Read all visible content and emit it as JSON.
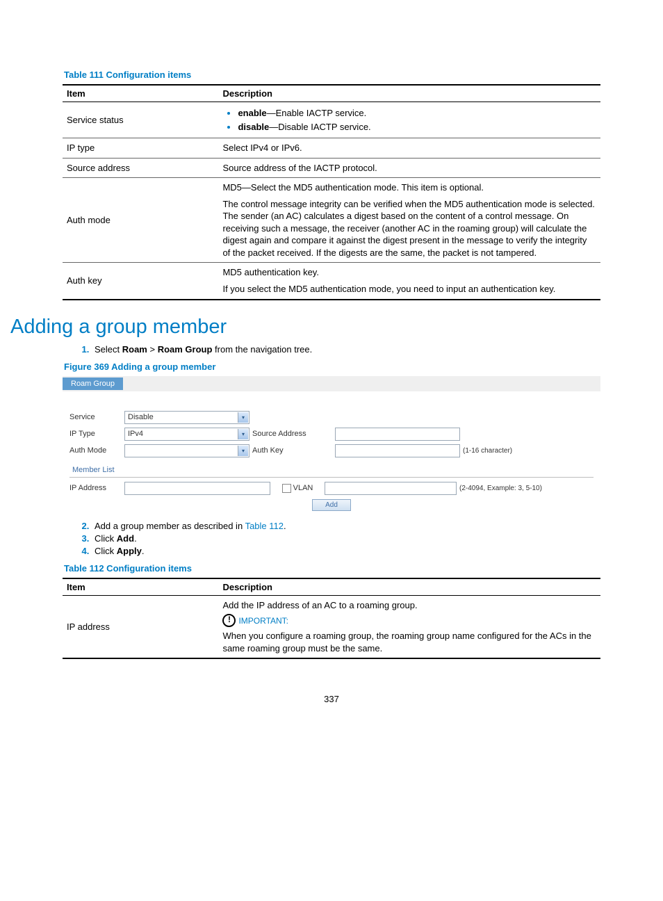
{
  "page_number": "337",
  "table111": {
    "caption": "Table 111 Configuration items",
    "head": {
      "c1": "Item",
      "c2": "Description"
    },
    "rows": {
      "r1": {
        "item": "Service status",
        "b1": "enable",
        "t1": "—Enable IACTP service.",
        "b2": "disable",
        "t2": "—Disable IACTP service."
      },
      "r2": {
        "item": "IP type",
        "desc": "Select IPv4 or IPv6."
      },
      "r3": {
        "item": "Source address",
        "desc": "Source address of the IACTP protocol."
      },
      "r4": {
        "item": "Auth mode",
        "p1": "MD5—Select the MD5 authentication mode. This item is optional.",
        "p2": "The control message integrity can be verified when the MD5 authentication mode is selected. The sender (an AC) calculates a digest based on the content of a control message. On receiving such a message, the receiver (another AC in the roaming group) will calculate the digest again and compare it against the digest present in the message to verify the integrity of the packet received. If the digests are the same, the packet is not tampered."
      },
      "r5": {
        "item": "Auth key",
        "p1": "MD5 authentication key.",
        "p2": "If you select the MD5 authentication mode, you need to input an authentication key."
      }
    }
  },
  "section": {
    "title": "Adding a group member",
    "step1_a": "Select ",
    "step1_b1": "Roam",
    "step1_gt": " > ",
    "step1_b2": "Roam Group",
    "step1_c": " from the navigation tree.",
    "figure_caption": "Figure 369 Adding a group member",
    "step2_a": "Add a group member as described in ",
    "step2_link": "Table 112",
    "step2_b": ".",
    "step3_a": "Click ",
    "step3_b": "Add",
    "step3_c": ".",
    "step4_a": "Click ",
    "step4_b": "Apply",
    "step4_c": "."
  },
  "figure": {
    "tab": "Roam Group",
    "service_lbl": "Service",
    "service_val": "Disable",
    "iptype_lbl": "IP Type",
    "iptype_val": "IPv4",
    "src_lbl": "Source Address",
    "authmode_lbl": "Auth Mode",
    "authkey_lbl": "Auth Key",
    "authkey_hint": "(1-16 character)",
    "member_list": "Member List",
    "ip_lbl": "IP Address",
    "vlan_lbl": "VLAN",
    "vlan_hint": "(2-4094, Example: 3, 5-10)",
    "add_btn": "Add"
  },
  "table112": {
    "caption": "Table 112 Configuration items",
    "head": {
      "c1": "Item",
      "c2": "Description"
    },
    "rows": {
      "r1": {
        "item": "IP address",
        "p1": "Add the IP address of an AC to a roaming group.",
        "important": "IMPORTANT:",
        "p2": "When you configure a roaming group, the roaming group name configured for the ACs in the same roaming group must be the same."
      }
    }
  }
}
